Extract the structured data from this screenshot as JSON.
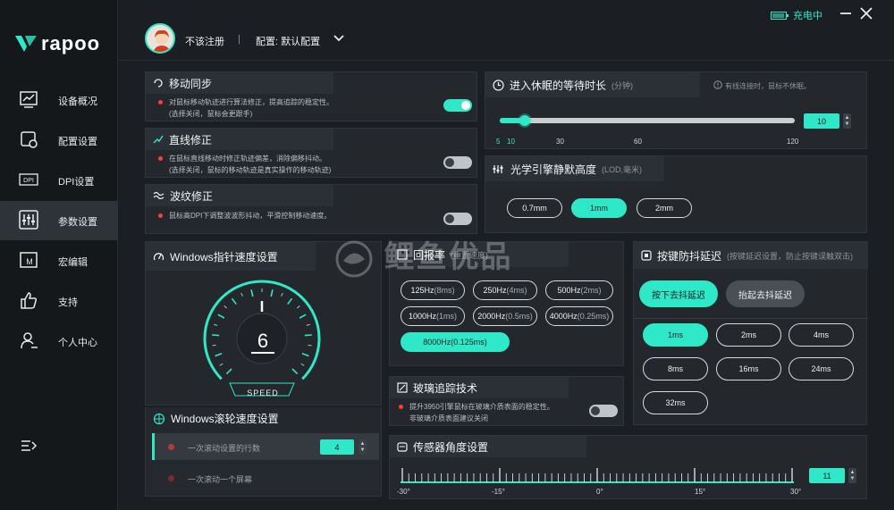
{
  "brand": {
    "name": "rapoo"
  },
  "sidebar": {
    "items": [
      {
        "label": "设备概况",
        "icon": "chart-icon"
      },
      {
        "label": "配置设置",
        "icon": "config-icon"
      },
      {
        "label": "DPI设置",
        "icon": "dpi-icon"
      },
      {
        "label": "参数设置",
        "icon": "sliders-icon"
      },
      {
        "label": "宏编辑",
        "icon": "macro-icon"
      },
      {
        "label": "支持",
        "icon": "thumbs-up-icon"
      },
      {
        "label": "个人中心",
        "icon": "user-icon"
      }
    ],
    "dpi_icon_text": "DPI",
    "macro_icon_text": "M"
  },
  "header": {
    "login": "不该注册",
    "separator": "|",
    "profile": "配置: 默认配置",
    "status": "充电中"
  },
  "motion_sync": {
    "title": "移动同步",
    "desc": "对鼠标移动轨迹进行算法修正，提高追踪的稳定性。(选择关闭，鼠标会更跟手)",
    "desc1": "对鼠标移动轨迹进行算法修正，提高追踪的稳定性。",
    "desc2": "(选择关闭，鼠标会更跟手)",
    "enabled": true
  },
  "angle_snap": {
    "title": "直线修正",
    "desc1": "在鼠标直线移动时修正轨迹偏差，消除偏移抖动。",
    "desc2": "(选择关闭，鼠标的移动轨迹是真实操作的移动轨迹)",
    "enabled": false
  },
  "ripple": {
    "title": "波纹修正",
    "desc1": "鼠标高DPI下调整波波形抖动，平滑控制移动速度。",
    "enabled": false
  },
  "sleep": {
    "title": "进入休眠的等待时长",
    "unit": "(分钟)",
    "note": "有线连接时，鼠标不休眠。",
    "value": "10",
    "value_num": 10,
    "ticks": [
      "5",
      "10",
      "30",
      "60",
      "120"
    ],
    "max": 120
  },
  "lod": {
    "title": "光学引擎静默高度",
    "unit": "(LOD,毫米)",
    "options": [
      "0.7mm",
      "1mm",
      "2mm"
    ],
    "selected": "1mm"
  },
  "pointer_speed": {
    "title": "Windows指针速度设置",
    "value": "6",
    "label": "SPEED",
    "max": 11
  },
  "polling": {
    "title": "回报率",
    "unit": "(重置速度)",
    "options": [
      {
        "main": "125Hz",
        "sub": "(8ms)"
      },
      {
        "main": "250Hz",
        "sub": "(4ms)"
      },
      {
        "main": "500Hz",
        "sub": "(2ms)"
      },
      {
        "main": "1000Hz",
        "sub": "(1ms)"
      },
      {
        "main": "2000Hz",
        "sub": "(0.5ms)"
      },
      {
        "main": "4000Hz",
        "sub": "(0.25ms)"
      },
      {
        "main": "8000Hz",
        "sub": "(0.125ms)"
      }
    ],
    "selected": "8000Hz"
  },
  "debounce": {
    "title": "按键防抖延迟",
    "unit": "(按键延迟设置，防止按键误触双击)",
    "press": "按下去抖延迟",
    "release": "抬起去抖延迟",
    "options": [
      "1ms",
      "2ms",
      "4ms",
      "8ms",
      "16ms",
      "24ms",
      "32ms"
    ],
    "selected": "1ms"
  },
  "glass": {
    "title": "玻璃追踪技术",
    "desc1": "提升3950引擎鼠标在玻璃介质表面的稳定性。",
    "desc2": "非玻璃介质表面建议关闭",
    "enabled": false
  },
  "scroll": {
    "title": "Windows滚轮速度设置",
    "rows": [
      {
        "label": "一次滚动设置的行数",
        "value": "4"
      },
      {
        "label": "一次滚动一个屏幕"
      }
    ]
  },
  "sensor_angle": {
    "title": "传感器角度设置",
    "value": "11",
    "ticks": [
      "-30°",
      "-15°",
      "0°",
      "15°",
      "30°"
    ]
  },
  "watermark": "鲤鱼优品",
  "colors": {
    "accent": "#2ee8c8",
    "alert": "#ff3c3c",
    "bg": "#1b1e22",
    "panel": "#24282d"
  }
}
